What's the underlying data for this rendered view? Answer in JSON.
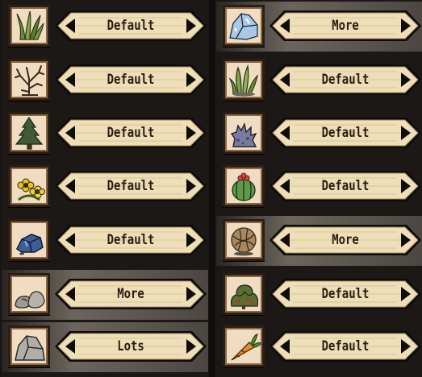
{
  "colors": {
    "background": "#171412",
    "plate": "#eedfb9",
    "icon_bg": "#f0ddc1",
    "text": "#2b1c12",
    "highlight": "#6b655d"
  },
  "left_column": [
    {
      "icon": "grass-icon",
      "value": "Default",
      "highlighted": false
    },
    {
      "icon": "twigs-sapling-icon",
      "value": "Default",
      "highlighted": false
    },
    {
      "icon": "evergreen-tree-icon",
      "value": "Default",
      "highlighted": false
    },
    {
      "icon": "flowers-icon",
      "value": "Default",
      "highlighted": false
    },
    {
      "icon": "blue-boulder-icon",
      "value": "Default",
      "highlighted": false
    },
    {
      "icon": "rocks-icon",
      "value": "More",
      "highlighted": true
    },
    {
      "icon": "boulder-icon",
      "value": "Lots",
      "highlighted": true
    }
  ],
  "right_column": [
    {
      "icon": "ice-icon",
      "value": "More",
      "highlighted": true
    },
    {
      "icon": "reeds-icon",
      "value": "Default",
      "highlighted": false
    },
    {
      "icon": "lichen-icon",
      "value": "Default",
      "highlighted": false
    },
    {
      "icon": "cactus-icon",
      "value": "Default",
      "highlighted": false
    },
    {
      "icon": "tumbleweed-icon",
      "value": "More",
      "highlighted": true
    },
    {
      "icon": "berry-bush-icon",
      "value": "Default",
      "highlighted": false
    },
    {
      "icon": "carrot-icon",
      "value": "Default",
      "highlighted": false
    }
  ]
}
